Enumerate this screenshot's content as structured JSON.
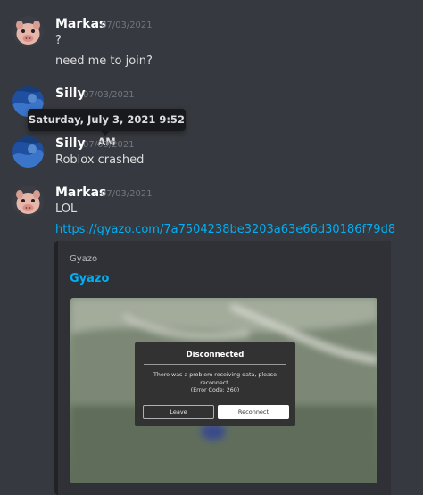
{
  "messages": [
    {
      "username": "Markas",
      "timestamp": "07/03/2021",
      "lines": [
        "?",
        "need me to join?"
      ],
      "avatar": "pig-avatar"
    },
    {
      "username": "Silly",
      "timestamp": "07/03/2021",
      "lines": [],
      "avatar": "blue-avatar"
    },
    {
      "username": "Silly",
      "timestamp": "07/03/2021",
      "lines": [
        "Roblox crashed"
      ],
      "avatar": "blue-avatar"
    },
    {
      "username": "Markas",
      "timestamp": "07/03/2021",
      "lines": [
        "LOL"
      ],
      "link": "https://gyazo.com/7a7504238be3203a63e66d30186f79d8",
      "avatar": "pig-avatar"
    }
  ],
  "tooltip": {
    "text": "Saturday, July 3, 2021 9:52 AM"
  },
  "embed": {
    "provider": "Gyazo",
    "title": "Gyazo",
    "dialog": {
      "title": "Disconnected",
      "body_line1": "There was a problem receiving data, please",
      "body_line2": "reconnect.",
      "body_line3": "(Error Code: 260)",
      "leave_label": "Leave",
      "reconnect_label": "Reconnect"
    }
  },
  "colors": {
    "background": "#36393f",
    "link": "#00aff4",
    "embed_bg": "#2f3136",
    "tooltip_bg": "#18191c"
  }
}
